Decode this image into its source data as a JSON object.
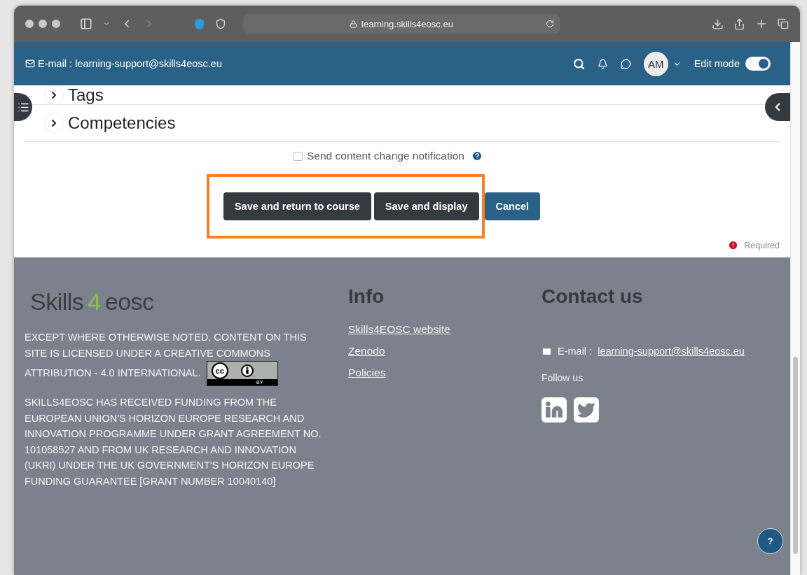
{
  "browser": {
    "url": "learning.skills4eosc.eu"
  },
  "navbar": {
    "email_label": "E-mail : learning-support@skills4eosc.eu",
    "avatar": "AM",
    "edit_mode": {
      "label": "Edit mode",
      "on": true
    }
  },
  "sections": [
    {
      "title": "Tags",
      "expanded": false
    },
    {
      "title": "Competencies",
      "expanded": false
    }
  ],
  "notification": {
    "label": "Send content change notification",
    "checked": false
  },
  "buttons": [
    {
      "label": "Save and return to course",
      "kind": "dark",
      "highlighted": true
    },
    {
      "label": "Save and display",
      "kind": "dark",
      "highlighted": true
    },
    {
      "label": "Cancel",
      "kind": "primary",
      "highlighted": false
    }
  ],
  "required_label": "Required",
  "footer": {
    "logo": {
      "parts": [
        "Skills",
        "4",
        "eosc"
      ]
    },
    "license_text": "EXCEPT WHERE OTHERWISE NOTED, CONTENT ON THIS SITE IS LICENSED UNDER A CREATIVE COMMONS ATTRIBUTION - 4.0 INTERNATIONAL.",
    "cc_badge": {
      "symbol": "cc",
      "label": "BY"
    },
    "funding_text": "SKILLS4EOSC HAS RECEIVED FUNDING FROM THE EUROPEAN UNION'S HORIZON EUROPE  RESEARCH AND INNOVATION PROGRAMME UNDER GRANT AGREEMENT NO. 101058527 AND FROM UK RESEARCH AND INNOVATION (UKRI) UNDER THE UK GOVERNMENT'S HORIZON EUROPE FUNDING GUARANTEE [GRANT NUMBER 10040140]",
    "info": {
      "heading": "Info",
      "links": [
        "Skills4EOSC website",
        "Zenodo",
        "Policies"
      ]
    },
    "contact": {
      "heading": "Contact us",
      "email_prefix": "E-mail :",
      "email": "learning-support@skills4eosc.eu",
      "follow_label": "Follow us"
    }
  },
  "help_button": "?"
}
